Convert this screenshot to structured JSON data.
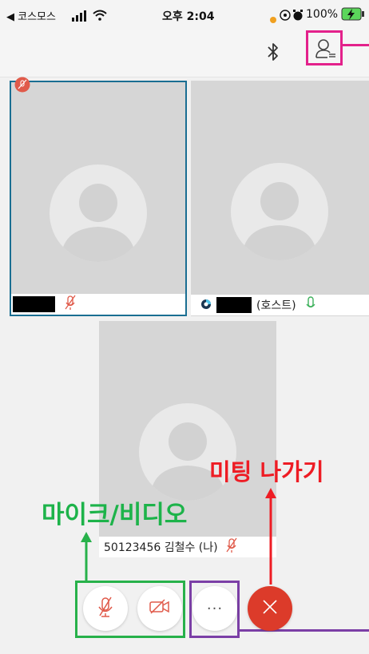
{
  "status_bar": {
    "carrier": "◀ 코스모스",
    "time": "오후 2:04",
    "battery": "100%"
  },
  "toolbar": {
    "bluetooth_icon": "bluetooth-icon",
    "participants_icon": "participant-list-icon"
  },
  "participants": [
    {
      "name_suffix": "",
      "mic_state": "muted"
    },
    {
      "name_suffix": "(호스트)",
      "mic_state": "on"
    },
    {
      "name_suffix": "50123456 김철수 (나)",
      "mic_state": "muted"
    }
  ],
  "controls": {
    "mic": "mic-muted-icon",
    "video": "video-off-icon",
    "more_label": "···",
    "leave": "close-icon"
  },
  "annotations": {
    "leave_meeting": "미팅 나가기",
    "mic_video": "마이크/비디오"
  },
  "colors": {
    "tile_border_active": "#1a6e92",
    "annotation_pink": "#e3218b",
    "annotation_green": "#27b14a",
    "annotation_red": "#ee1c24",
    "annotation_purple": "#7b3fa6",
    "leave_button": "#dc3b2a",
    "mic_muted": "#e05a4a",
    "mic_on": "#3cb05a"
  }
}
